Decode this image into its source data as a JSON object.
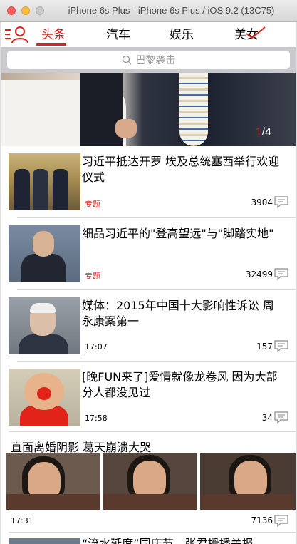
{
  "window": {
    "title": "iPhone 6s Plus - iPhone 6s Plus / iOS 9.2 (13C75)"
  },
  "tabs": [
    {
      "label": "头条",
      "active": true
    },
    {
      "label": "汽车",
      "active": false
    },
    {
      "label": "娱乐",
      "active": false
    },
    {
      "label": "美女",
      "active": false
    }
  ],
  "search": {
    "placeholder": "巴黎袭击"
  },
  "banner": {
    "pager_current": "1",
    "pager_total": "/4"
  },
  "news": [
    {
      "headline": "习近平抵达开罗 埃及总统塞西举行欢迎仪式",
      "tag": "专题",
      "time": "",
      "comments": "3904"
    },
    {
      "headline": "细品习近平的\"登高望远\"与\"脚踏实地\"",
      "tag": "专题",
      "time": "",
      "comments": "32499"
    },
    {
      "headline": "媒体：2015年中国十大影响性诉讼 周永康案第一",
      "tag": "",
      "time": "17:07",
      "comments": "157"
    },
    {
      "headline": "[晚FUN来了]爱情就像龙卷风 因为大部分人都没见过",
      "tag": "",
      "time": "17:58",
      "comments": "34"
    }
  ],
  "gallery": {
    "title": "直面离婚阴影 葛天崩溃大哭",
    "time": "17:31",
    "comments": "7136"
  },
  "next_item_peek": "“流水延席”国庆节，张君授播关报",
  "colors": {
    "accent": "#e3211b",
    "search_bg": "#c9c9ce"
  }
}
